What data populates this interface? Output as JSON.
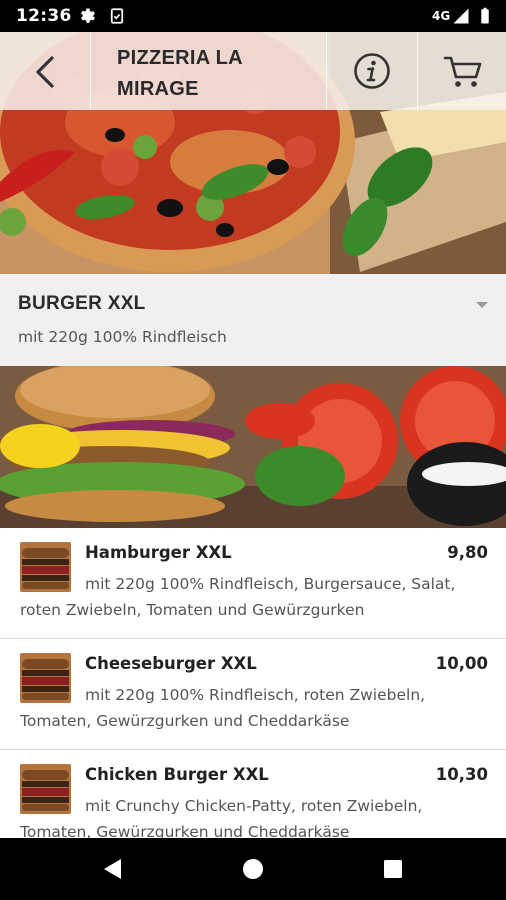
{
  "status_bar": {
    "time": "12:36",
    "network": "4G",
    "icons": [
      "gear-icon",
      "clipboard-icon",
      "signal-icon",
      "battery-icon"
    ]
  },
  "header": {
    "title": "PIZZERIA LA MIRAGE",
    "back_icon": "chevron-left-icon",
    "info_icon": "info-icon",
    "cart_icon": "cart-icon"
  },
  "category": {
    "name": "BURGER XXL",
    "description": "mit 220g 100% Rindfleisch",
    "toggle_icon": "caret-down-icon"
  },
  "menu_items": [
    {
      "name": "Hamburger XXL",
      "price": "9,80",
      "description": "mit 220g 100% Rindfleisch, Burgersauce, Salat, roten Zwiebeln, Tomaten und Gewürzgurken"
    },
    {
      "name": "Cheeseburger XXL",
      "price": "10,00",
      "description": "mit 220g 100% Rindfleisch, roten Zwiebeln, Tomaten, Gewürzgurken und Cheddarkäse"
    },
    {
      "name": "Chicken Burger XXL",
      "price": "10,30",
      "description": "mit Crunchy Chicken-Patty, roten Zwiebeln, Tomaten, Gewürzgurken und Cheddarkäse"
    }
  ],
  "nav_bar": {
    "icons": [
      "back-triangle-icon",
      "home-circle-icon",
      "recents-square-icon"
    ]
  },
  "colors": {
    "status_bar": "#000000",
    "category_bg": "#f0f0f0",
    "text_dark": "#222222",
    "text_muted": "#555555"
  }
}
